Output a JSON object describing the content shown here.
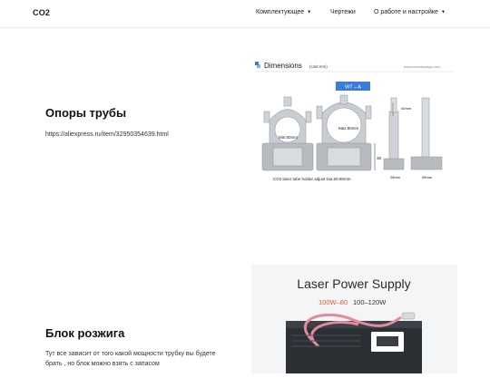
{
  "header": {
    "logo": "CO2",
    "nav": [
      {
        "label": "Комплектующее",
        "has_dropdown": true
      },
      {
        "label": "Чертежи",
        "has_dropdown": false
      },
      {
        "label": "О работе и настройке",
        "has_dropdown": true
      }
    ]
  },
  "section1": {
    "title": "Опоры трубы",
    "link": "https://aliexpress.ru/item/32950354639.html",
    "figure": {
      "heading": "Dimensions",
      "unit": "(Unit:mm)",
      "site": "www.wavetopsign.com",
      "badge": "WT – A",
      "min_label": "Min:50mm",
      "max_label": "Max:80mm",
      "dim_40": "40mm",
      "dim_38": "38",
      "dim_28": "28mm",
      "dim_98": "98mm",
      "caption": "CO2 laser tube holder adjust Dia.50-80mm"
    }
  },
  "section2": {
    "title": "Блок розжига",
    "text_line1": "Тут все зависит от того какой мощности трубку вы будете",
    "text_line2": "брать , но блок можно взять с запасом",
    "figure": {
      "title": "Laser Power Supply",
      "power_red": "100W–80",
      "power_rest": "100–120W"
    }
  },
  "colors": {
    "accent_blue": "#3d7bd9",
    "accent_red": "#e05a2a"
  }
}
